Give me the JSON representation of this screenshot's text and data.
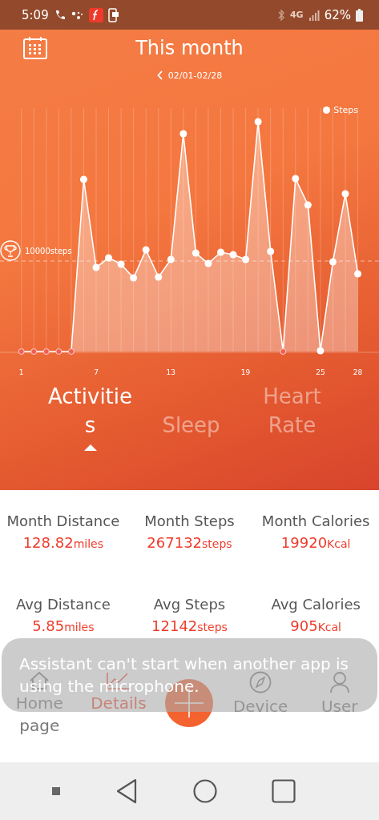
{
  "status_bar": {
    "time": "5:09",
    "network": "4G",
    "battery": "62%"
  },
  "header": {
    "title": "This month",
    "date_range": "02/01-02/28"
  },
  "chart": {
    "legend": "Steps",
    "goal_label": "10000steps",
    "x_labels": [
      "1",
      "7",
      "13",
      "19",
      "25",
      "28"
    ]
  },
  "tabs": [
    {
      "label": "Activities",
      "selected": true
    },
    {
      "label": "Sleep",
      "selected": false
    },
    {
      "label": "Heart Rate",
      "selected": false
    }
  ],
  "stats": [
    {
      "label": "Month Distance",
      "value": "128.82",
      "unit": "miles"
    },
    {
      "label": "Month Steps",
      "value": "267132",
      "unit": "steps"
    },
    {
      "label": "Month Calories",
      "value": "19920",
      "unit": "Kcal"
    },
    {
      "label": "Avg Distance",
      "value": "5.85",
      "unit": "miles"
    },
    {
      "label": "Avg Steps",
      "value": "12142",
      "unit": "steps"
    },
    {
      "label": "Avg Calories",
      "value": "905",
      "unit": "Kcal"
    }
  ],
  "bottom_nav": [
    {
      "label": "Home page",
      "selected": false
    },
    {
      "label": "Details",
      "selected": true
    },
    {
      "label": "Device",
      "selected": false
    },
    {
      "label": "User",
      "selected": false
    }
  ],
  "toast": "Assistant can't start when another app is using the microphone."
}
